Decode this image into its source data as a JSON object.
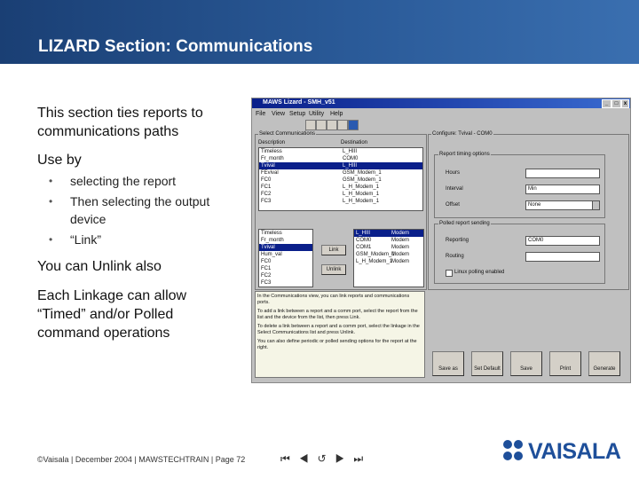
{
  "slide": {
    "title": "LIZARD Section: Communications",
    "intro": [
      "This section ties reports to",
      "communications paths"
    ],
    "use_by": "Use by",
    "bullets": [
      "selecting the report",
      "Then selecting the output device",
      "“Link”"
    ],
    "unlink": "You can Unlink also",
    "linkage": [
      "Each Linkage can allow",
      "“Timed” and/or Polled",
      "command operations"
    ],
    "footer": "©Vaisala | December 2004 | MAWSTECHTRAIN | Page 72",
    "nav_symbols": [
      "⏮",
      "◀",
      "↺",
      "▶",
      "⏭"
    ],
    "logo_text": "VAISALA",
    "colors": {
      "header_blue": "#2a5a98",
      "logo_blue": "#1e4f9a"
    }
  },
  "screenshot": {
    "window_title": "MAWS Lizard - SMH_v51",
    "menu": [
      "File",
      "View",
      "Setup",
      "Utility",
      "Help"
    ],
    "select_comms_label": "Select Communications",
    "report_col": "Description",
    "dest_col": "Destination",
    "reports": [
      {
        "name": "Timeless",
        "dest": "L_HIII",
        "sel": false
      },
      {
        "name": "Fr_month",
        "dest": "COM0",
        "sel": false
      },
      {
        "name": "Tvival",
        "dest": "L_HIII",
        "sel": true
      },
      {
        "name": "FEvival",
        "dest": "GSM_Modem_1",
        "sel": false
      },
      {
        "name": "FC0",
        "dest": "GSM_Modem_1",
        "sel": false
      },
      {
        "name": "FC1",
        "dest": "L_H_Modem_1",
        "sel": false
      },
      {
        "name": "FC2",
        "dest": "L_H_Modem_1",
        "sel": false
      },
      {
        "name": "FC3",
        "dest": "L_H_Modem_1",
        "sel": false
      }
    ],
    "available_reports": [
      "Timeless",
      "Fr_month",
      "Tvival",
      "Hum_val",
      "FC0",
      "FC1",
      "FC2",
      "FC3"
    ],
    "devices": [
      {
        "port": "L_HIII",
        "name": "Modem",
        "sel": true
      },
      {
        "port": "COM0",
        "name": "Modem",
        "sel": false
      },
      {
        "port": "COM1",
        "name": "Modem",
        "sel": false
      },
      {
        "port": "GSM_Modem_1",
        "name": "Modem",
        "sel": false
      },
      {
        "port": "L_H_Modem_1",
        "name": "Modem",
        "sel": false
      }
    ],
    "link_btn": "Link",
    "unlink_btn": "Unlink",
    "configure_label": "Configure: Tvival - COM0",
    "timing_label": "Report timing options",
    "timing_fields": [
      "Hours",
      "Interval",
      "Offset"
    ],
    "interval_value": "Min",
    "offset_value": "None",
    "polled_label": "Polled report sending",
    "polled_fields": [
      "Reporting",
      "Routing"
    ],
    "polled_value": "COM0",
    "polled_check": "Linux polling enabled",
    "help_text": [
      "In the Communications view, you can link reports and communications ports.",
      "To add a link between a report and a comm port, select the report from the list and the device from the list, then press Link.",
      "To delete a link between a report and a comm port, select the linkage in the Select Communications list and press Unlink.",
      "You can also define periodic or polled sending options for the report at the right."
    ],
    "bottom_buttons": [
      "Save as",
      "Set Default",
      "Save",
      "Print",
      "Generate"
    ]
  }
}
